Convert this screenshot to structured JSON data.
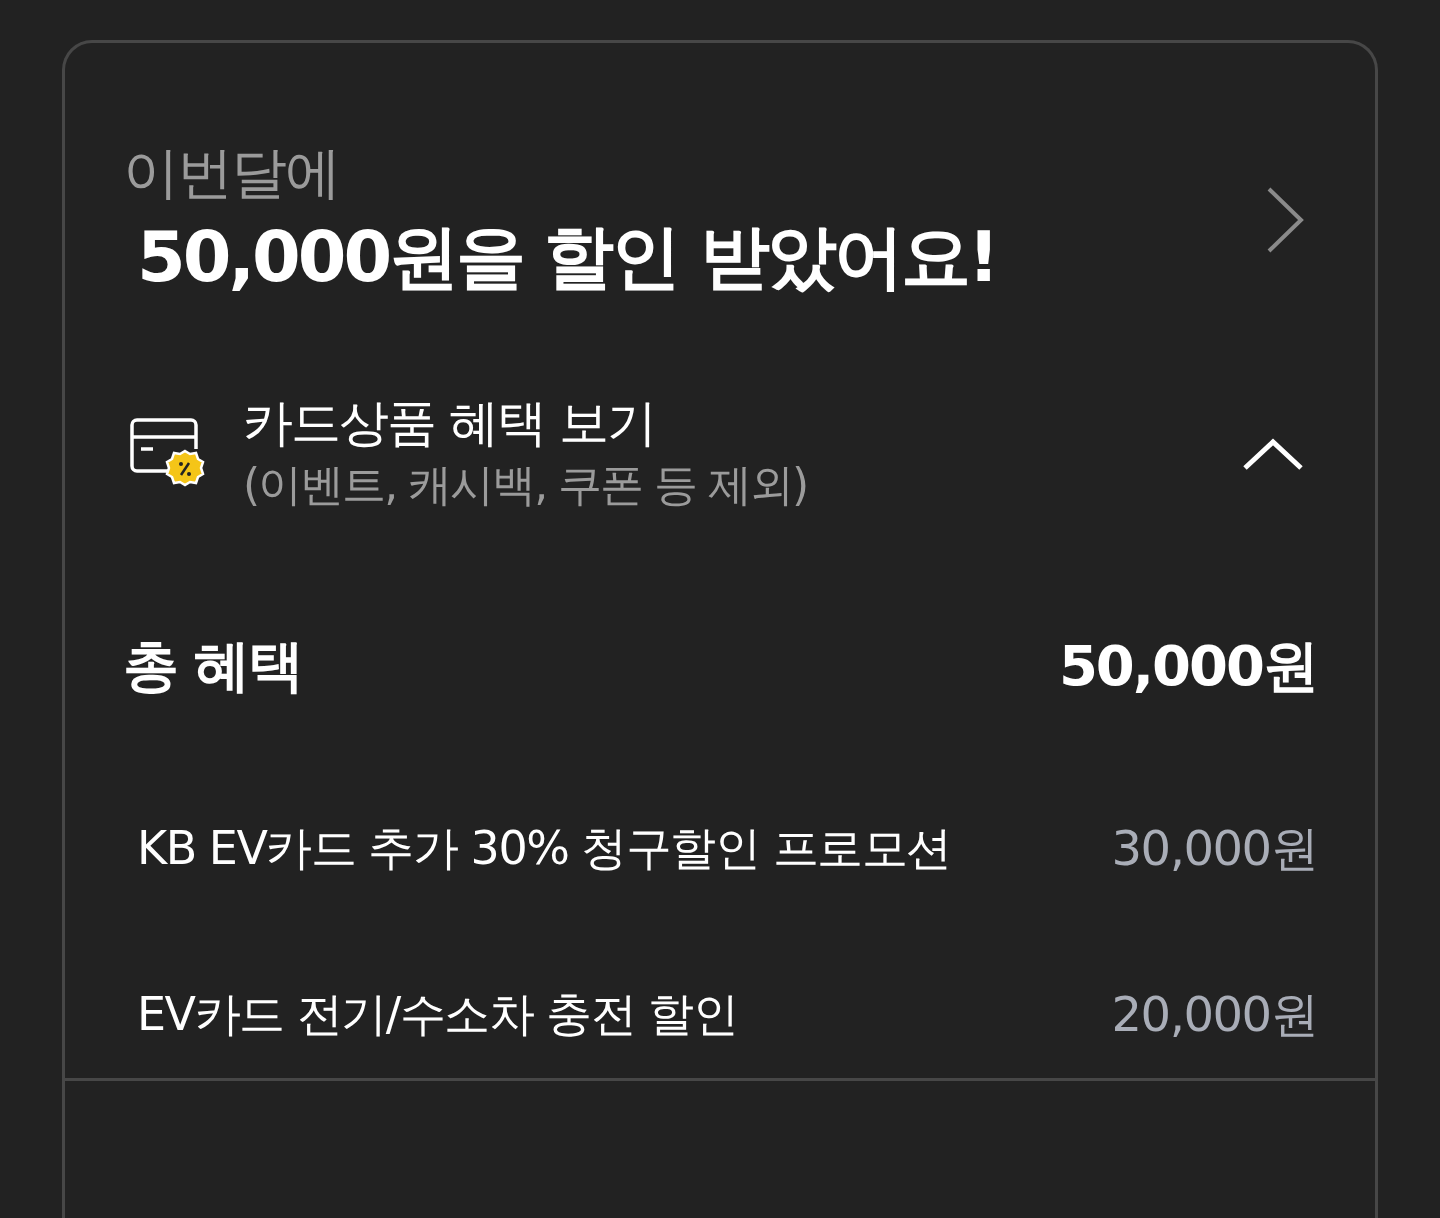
{
  "header": {
    "label": "이번달에",
    "headline": "50,000원을 할인 받았어요!"
  },
  "benefits": {
    "title": "카드상품 혜택 보기",
    "subtitle": "(이벤트, 캐시백, 쿠폰 등 제외)",
    "expanded": true
  },
  "total": {
    "label": "총 혜택",
    "amount": "50,000원"
  },
  "items": [
    {
      "name": "KB EV카드 추가 30% 청구할인 프로모션",
      "amount": "30,000원"
    },
    {
      "name": "EV카드 전기/수소차 충전 할인",
      "amount": "20,000원"
    }
  ]
}
